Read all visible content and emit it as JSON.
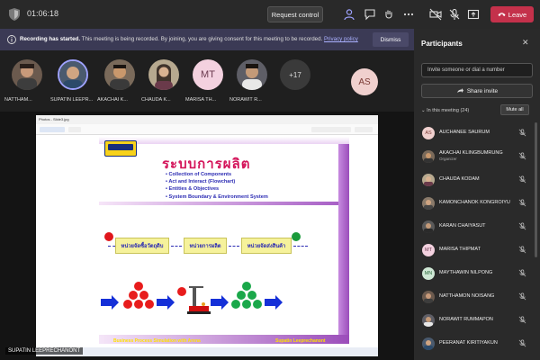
{
  "topbar": {
    "timer": "01:06:18",
    "request_control_label": "Request control",
    "leave_label": "Leave"
  },
  "banner": {
    "bold_text": "Recording has started.",
    "text": " This meeting is being recorded. By joining, you are giving consent for this meeting to be recorded. ",
    "policy_link": "Privacy policy",
    "dismiss_label": "Dismiss"
  },
  "strip": {
    "tiles": [
      {
        "name": "NATTHAM..."
      },
      {
        "name": "SUPATIN LEEPR..."
      },
      {
        "name": "AKACHAI K..."
      },
      {
        "name": "CHAUDA K..."
      },
      {
        "name": "MARISA TH...",
        "initials": "MT"
      },
      {
        "name": "NORAWIT R..."
      }
    ],
    "more_count": "+17",
    "self_initials": "AS"
  },
  "share": {
    "photos_title": "Photos - Slide3.jpg",
    "slide_title": "ระบบการผลิต",
    "bullets": [
      "Collection of Components",
      "Act and Interact (Flowchart)",
      "Entities & Objectives",
      "System Boundary & Environment System"
    ],
    "boxes": [
      "หน่วยจัดซื้อวัตถุดิบ",
      "หน่วยการผลิต",
      "หน่วยจัดส่งสินค้า"
    ],
    "footer_left": "Business Process Simulation with Arena",
    "footer_right": "Supatin Leeprechanont",
    "presenter": "SUPATIN LEEPRECHANONT"
  },
  "panel": {
    "title": "Participants",
    "invite_placeholder": "Invite someone or dial a number",
    "share_invite_label": "Share invite",
    "in_meeting_label": "In this meeting (24)",
    "mute_all_label": "Mute all",
    "participants": [
      {
        "name": "AUCHANEE SAURUM",
        "initials": "AS",
        "color": "#f0d0ce",
        "fg": "#7b3b35"
      },
      {
        "name": "AKACHAI KLINGBUMRUNG",
        "role": "Organizer",
        "photo": true
      },
      {
        "name": "CHAUDA KODAM",
        "photo": true
      },
      {
        "name": "KAMONCHANOK KONGROIYU",
        "photo": true
      },
      {
        "name": "KARAN CHAIYASUT",
        "photo": true
      },
      {
        "name": "MARISA THIPMAT",
        "initials": "MT",
        "color": "#f3d1df",
        "fg": "#6b3a4f"
      },
      {
        "name": "MAYTHAWIN NILPONG",
        "initials": "MN",
        "color": "#cfe8d5",
        "fg": "#2e6b3e"
      },
      {
        "name": "NATTHAMON NOISANG",
        "photo": true
      },
      {
        "name": "NORAWIT RUMMAPON",
        "photo": true
      },
      {
        "name": "PEERANAT KIRITIYAKUN",
        "photo": true
      }
    ]
  }
}
